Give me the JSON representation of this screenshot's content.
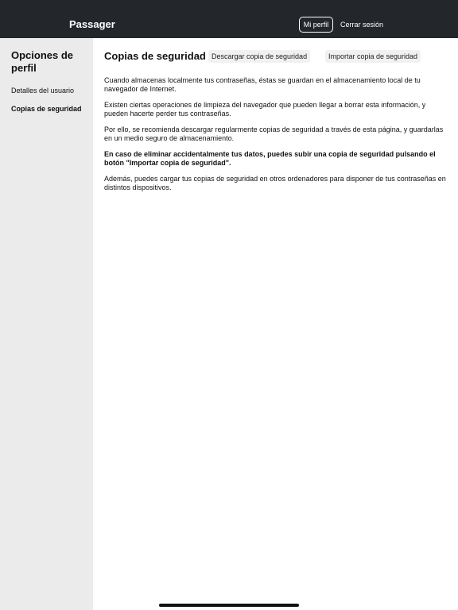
{
  "header": {
    "brand": "Passager",
    "profile_label": "Mi perfil",
    "logout_label": "Cerrar sesión"
  },
  "sidebar": {
    "title": "Opciones de perfil",
    "items": [
      {
        "label": "Detalles del usuario"
      },
      {
        "label": "Copias de seguridad"
      }
    ]
  },
  "main": {
    "title": "Copias de seguridad",
    "download_label": "Descargar copia de seguridad",
    "import_label": "Importar copia de seguridad",
    "paragraphs": [
      "Cuando almacenas localmente tus contraseñas, éstas se guardan en el almacenamiento local de tu navegador de Internet.",
      "Existen ciertas operaciones de limpieza del navegador que pueden llegar a borrar esta información, y pueden hacerte perder tus contraseñas.",
      "Por ello, se recomienda descargar regularmente copias de seguridad a través de esta página, y guardarlas en un medio seguro de almacenamiento.",
      "En caso de eliminar accidentalmente tus datos, puedes subir una copia de seguridad pulsando el botón \"Importar copia de seguridad\".",
      "Además, puedes cargar tus copias de seguridad en otros ordenadores para disponer de tus contraseñas en distintos dispositivos."
    ]
  },
  "colors": {
    "header_bg": "#23262b",
    "sidebar_bg": "#ebebeb",
    "button_bg": "#f1f1f1"
  }
}
